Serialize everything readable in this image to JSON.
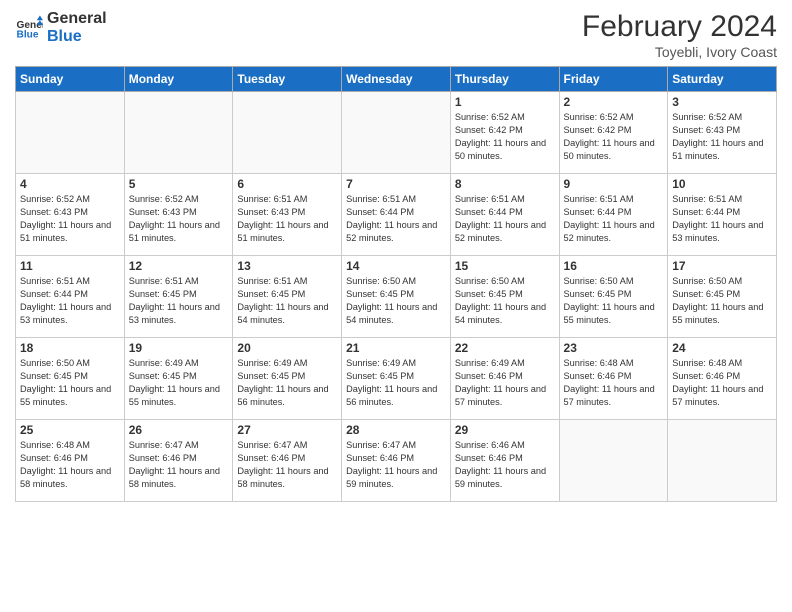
{
  "header": {
    "logo_line1": "General",
    "logo_line2": "Blue",
    "month_year": "February 2024",
    "location": "Toyebli, Ivory Coast"
  },
  "days_of_week": [
    "Sunday",
    "Monday",
    "Tuesday",
    "Wednesday",
    "Thursday",
    "Friday",
    "Saturday"
  ],
  "weeks": [
    [
      {
        "day": "",
        "info": ""
      },
      {
        "day": "",
        "info": ""
      },
      {
        "day": "",
        "info": ""
      },
      {
        "day": "",
        "info": ""
      },
      {
        "day": "1",
        "info": "Sunrise: 6:52 AM\nSunset: 6:42 PM\nDaylight: 11 hours\nand 50 minutes."
      },
      {
        "day": "2",
        "info": "Sunrise: 6:52 AM\nSunset: 6:42 PM\nDaylight: 11 hours\nand 50 minutes."
      },
      {
        "day": "3",
        "info": "Sunrise: 6:52 AM\nSunset: 6:43 PM\nDaylight: 11 hours\nand 51 minutes."
      }
    ],
    [
      {
        "day": "4",
        "info": "Sunrise: 6:52 AM\nSunset: 6:43 PM\nDaylight: 11 hours\nand 51 minutes."
      },
      {
        "day": "5",
        "info": "Sunrise: 6:52 AM\nSunset: 6:43 PM\nDaylight: 11 hours\nand 51 minutes."
      },
      {
        "day": "6",
        "info": "Sunrise: 6:51 AM\nSunset: 6:43 PM\nDaylight: 11 hours\nand 51 minutes."
      },
      {
        "day": "7",
        "info": "Sunrise: 6:51 AM\nSunset: 6:44 PM\nDaylight: 11 hours\nand 52 minutes."
      },
      {
        "day": "8",
        "info": "Sunrise: 6:51 AM\nSunset: 6:44 PM\nDaylight: 11 hours\nand 52 minutes."
      },
      {
        "day": "9",
        "info": "Sunrise: 6:51 AM\nSunset: 6:44 PM\nDaylight: 11 hours\nand 52 minutes."
      },
      {
        "day": "10",
        "info": "Sunrise: 6:51 AM\nSunset: 6:44 PM\nDaylight: 11 hours\nand 53 minutes."
      }
    ],
    [
      {
        "day": "11",
        "info": "Sunrise: 6:51 AM\nSunset: 6:44 PM\nDaylight: 11 hours\nand 53 minutes."
      },
      {
        "day": "12",
        "info": "Sunrise: 6:51 AM\nSunset: 6:45 PM\nDaylight: 11 hours\nand 53 minutes."
      },
      {
        "day": "13",
        "info": "Sunrise: 6:51 AM\nSunset: 6:45 PM\nDaylight: 11 hours\nand 54 minutes."
      },
      {
        "day": "14",
        "info": "Sunrise: 6:50 AM\nSunset: 6:45 PM\nDaylight: 11 hours\nand 54 minutes."
      },
      {
        "day": "15",
        "info": "Sunrise: 6:50 AM\nSunset: 6:45 PM\nDaylight: 11 hours\nand 54 minutes."
      },
      {
        "day": "16",
        "info": "Sunrise: 6:50 AM\nSunset: 6:45 PM\nDaylight: 11 hours\nand 55 minutes."
      },
      {
        "day": "17",
        "info": "Sunrise: 6:50 AM\nSunset: 6:45 PM\nDaylight: 11 hours\nand 55 minutes."
      }
    ],
    [
      {
        "day": "18",
        "info": "Sunrise: 6:50 AM\nSunset: 6:45 PM\nDaylight: 11 hours\nand 55 minutes."
      },
      {
        "day": "19",
        "info": "Sunrise: 6:49 AM\nSunset: 6:45 PM\nDaylight: 11 hours\nand 55 minutes."
      },
      {
        "day": "20",
        "info": "Sunrise: 6:49 AM\nSunset: 6:45 PM\nDaylight: 11 hours\nand 56 minutes."
      },
      {
        "day": "21",
        "info": "Sunrise: 6:49 AM\nSunset: 6:45 PM\nDaylight: 11 hours\nand 56 minutes."
      },
      {
        "day": "22",
        "info": "Sunrise: 6:49 AM\nSunset: 6:46 PM\nDaylight: 11 hours\nand 57 minutes."
      },
      {
        "day": "23",
        "info": "Sunrise: 6:48 AM\nSunset: 6:46 PM\nDaylight: 11 hours\nand 57 minutes."
      },
      {
        "day": "24",
        "info": "Sunrise: 6:48 AM\nSunset: 6:46 PM\nDaylight: 11 hours\nand 57 minutes."
      }
    ],
    [
      {
        "day": "25",
        "info": "Sunrise: 6:48 AM\nSunset: 6:46 PM\nDaylight: 11 hours\nand 58 minutes."
      },
      {
        "day": "26",
        "info": "Sunrise: 6:47 AM\nSunset: 6:46 PM\nDaylight: 11 hours\nand 58 minutes."
      },
      {
        "day": "27",
        "info": "Sunrise: 6:47 AM\nSunset: 6:46 PM\nDaylight: 11 hours\nand 58 minutes."
      },
      {
        "day": "28",
        "info": "Sunrise: 6:47 AM\nSunset: 6:46 PM\nDaylight: 11 hours\nand 59 minutes."
      },
      {
        "day": "29",
        "info": "Sunrise: 6:46 AM\nSunset: 6:46 PM\nDaylight: 11 hours\nand 59 minutes."
      },
      {
        "day": "",
        "info": ""
      },
      {
        "day": "",
        "info": ""
      }
    ]
  ]
}
